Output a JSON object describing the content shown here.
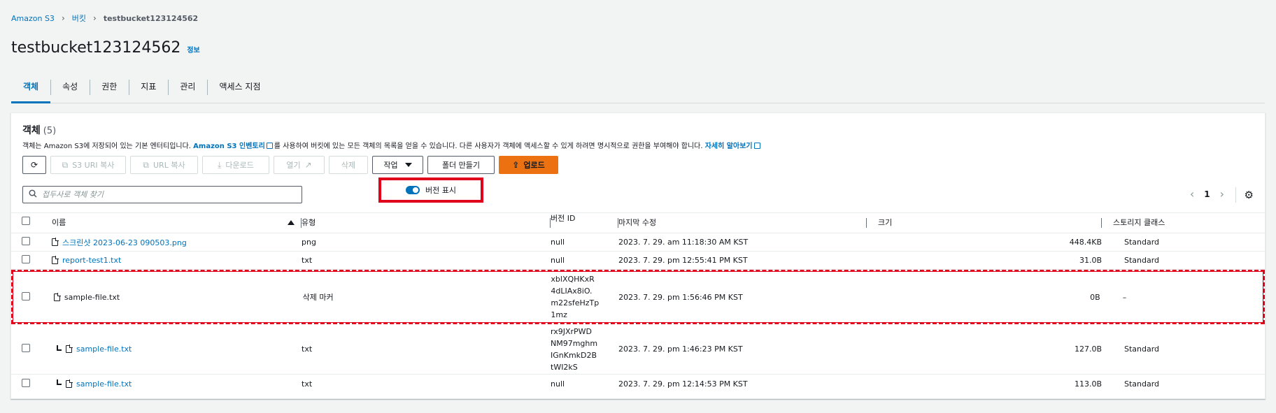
{
  "breadcrumb": {
    "root": "Amazon S3",
    "buckets": "버킷",
    "current": "testbucket123124562"
  },
  "header": {
    "title": "testbucket123124562",
    "info_link": "정보"
  },
  "tabs": [
    {
      "label": "객체",
      "active": true
    },
    {
      "label": "속성"
    },
    {
      "label": "권한"
    },
    {
      "label": "지표"
    },
    {
      "label": "관리"
    },
    {
      "label": "액세스 지점"
    }
  ],
  "panel": {
    "title": "객체",
    "count": "(5)",
    "desc_prefix": "객체는 Amazon S3에 저장되어 있는 기본 엔터티입니다. ",
    "desc_link": "Amazon S3 인벤토리",
    "desc_mid": "를 사용하여 버킷에 있는 모든 객체의 목록을 얻을 수 있습니다. 다른 사용자가 객체에 액세스할 수 있게 하려면 명시적으로 권한을 부여해야 합니다. ",
    "desc_learn": "자세히 알아보기"
  },
  "toolbar": {
    "copy_s3_uri": "S3 URI 복사",
    "copy_url": "URL 복사",
    "download": "다운로드",
    "open": "열기",
    "delete": "삭제",
    "actions": "작업",
    "create_folder": "폴더 만들기",
    "upload": "업로드"
  },
  "search": {
    "placeholder": "접두사로 객체 찾기"
  },
  "version_toggle": {
    "label": "버전 표시",
    "on": true
  },
  "pager": {
    "page": "1"
  },
  "table": {
    "columns": {
      "name": "이름",
      "type": "유형",
      "version_id": "버전 ID",
      "last_modified": "마지막 수정",
      "size": "크기",
      "storage_class": "스토리지 클래스"
    },
    "rows": [
      {
        "name": "스크린샷 2023-06-23 090503.png",
        "type": "png",
        "version_id": "null",
        "last_modified": "2023. 7. 29. am 11:18:30 AM KST",
        "size": "448.4KB",
        "storage_class": "Standard"
      },
      {
        "name": "report-test1.txt",
        "type": "txt",
        "version_id": "null",
        "last_modified": "2023. 7. 29. pm 12:55:41 PM KST",
        "size": "31.0B",
        "storage_class": "Standard"
      },
      {
        "name": "sample-file.txt",
        "type": "삭제 마커",
        "version_id": [
          "xblXQHKxR",
          "4dLIAx8iO.",
          "m22sfeHzTp",
          "1mz"
        ],
        "last_modified": "2023. 7. 29. pm 1:56:46 PM KST",
        "size": "0B",
        "storage_class": "–"
      },
      {
        "name": "sample-file.txt",
        "type": "txt",
        "version_id": [
          "rx9JXrPWD",
          "NM97mghm",
          "IGnKmkD2B",
          "tWI2kS"
        ],
        "last_modified": "2023. 7. 29. pm 1:46:23 PM KST",
        "size": "127.0B",
        "storage_class": "Standard"
      },
      {
        "name": "sample-file.txt",
        "type": "txt",
        "version_id": "null",
        "last_modified": "2023. 7. 29. pm 12:14:53 PM KST",
        "size": "113.0B",
        "storage_class": "Standard"
      }
    ]
  },
  "colors": {
    "link": "#0073bb",
    "primary": "#ec7211",
    "highlight": "#e0001b"
  },
  "icons": [
    "refresh-icon",
    "copy-icon",
    "download-icon",
    "external-link-icon",
    "upload-icon",
    "search-icon",
    "settings-icon",
    "file-icon",
    "child-version-icon",
    "sort-ascending-icon",
    "chevron-left-icon",
    "chevron-right-icon"
  ]
}
